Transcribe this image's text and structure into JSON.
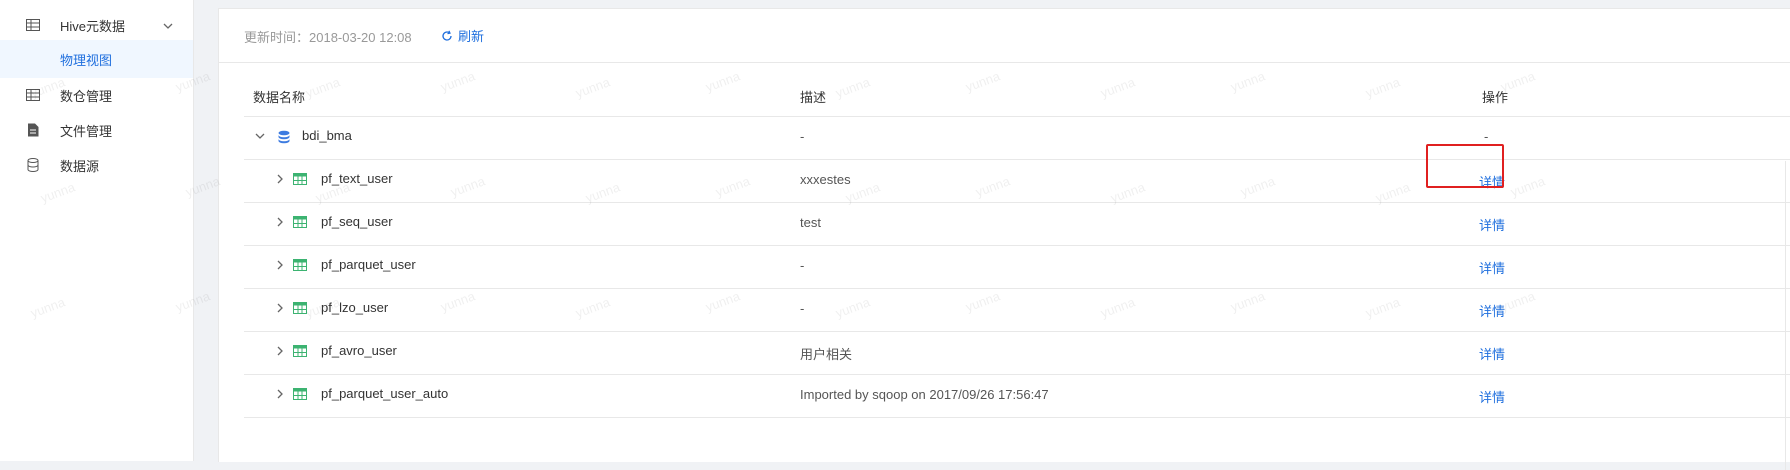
{
  "sidebar": {
    "items": [
      {
        "label": "Hive元数据",
        "icon": "table-icon",
        "expanded": true
      },
      {
        "label": "物理视图",
        "active": true
      },
      {
        "label": "数仓管理",
        "icon": "table-icon"
      },
      {
        "label": "文件管理",
        "icon": "file-icon"
      },
      {
        "label": "数据源",
        "icon": "database-icon"
      }
    ]
  },
  "toolbar": {
    "update_text": "更新时间：2018-03-20 12:08",
    "refresh_label": "刷新"
  },
  "table": {
    "headers": {
      "name": "数据名称",
      "desc": "描述",
      "op": "操作"
    },
    "database": {
      "name": "bdi_bma",
      "desc": "-",
      "op": "-"
    },
    "rows": [
      {
        "name": "pf_text_user",
        "desc": "xxxestes",
        "op": "详情"
      },
      {
        "name": "pf_seq_user",
        "desc": "test",
        "op": "详情"
      },
      {
        "name": "pf_parquet_user",
        "desc": "-",
        "op": "详情"
      },
      {
        "name": "pf_lzo_user",
        "desc": "-",
        "op": "详情"
      },
      {
        "name": "pf_avro_user",
        "desc": "用户相关",
        "op": "详情"
      },
      {
        "name": "pf_parquet_user_auto",
        "desc": "Imported by sqoop on 2017/09/26 17:56:47",
        "op": "详情"
      }
    ]
  },
  "watermark_text": "yunna",
  "colors": {
    "accent": "#1f6fde",
    "highlight": "#e02020",
    "table_icon": "#3cb371"
  }
}
